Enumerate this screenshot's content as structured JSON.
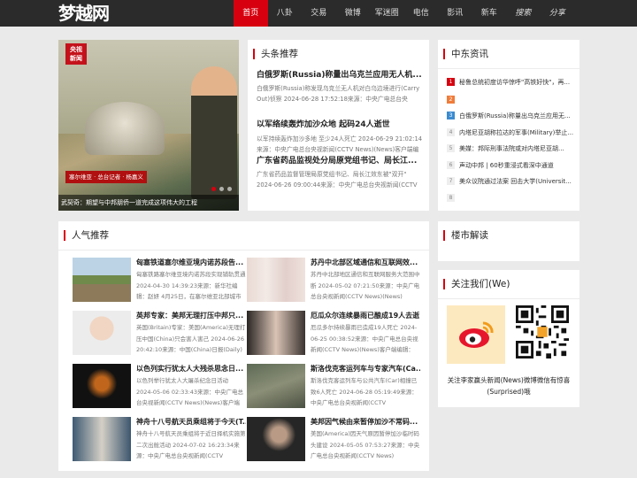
{
  "brand": {
    "logo": "梦越网",
    "accent": "#d7000f"
  },
  "nav": [
    {
      "label": "首页",
      "active": true
    },
    {
      "label": "八卦"
    },
    {
      "label": "交易"
    },
    {
      "label": "微博"
    },
    {
      "label": "军迷圈"
    },
    {
      "label": "电信"
    },
    {
      "label": "影讯"
    },
    {
      "label": "新车"
    },
    {
      "label": "搜索"
    },
    {
      "label": "分享"
    }
  ],
  "hero": {
    "logo_top": "央视",
    "logo_bottom": "新闻",
    "tag": "塞尔维亚 · 总台记者 · 杨嘉义",
    "caption": "武契奇：期望与中邦朋侨一道完成这项伟大的工程",
    "dots": 3
  },
  "headlines": {
    "title": "头条推荐",
    "items": [
      {
        "title": "白俄罗斯(Russia)称量出乌克兰应用无人机...",
        "desc": "白俄罗斯(Russia)称发现乌克兰无人机对白乌边境进行(Carry Out)侦察 2024-06-28 17:52:18来源：中央广电总台央"
      },
      {
        "title": "以军络续轰炸加沙众地 起码24人逝世",
        "desc": "以军持续轰炸加沙多地 至少24人死亡 2024-06-29 21:02:14来源：中央广电总台央视新闻(CCTV News)(News)客户端编辑："
      },
      {
        "title": "广东省药品监视处分局原党组书记、局长江...",
        "desc": "广东省药品监督管理局原党组书记、局长江效东被\"双开\" 2024-06-26 09:00:44来源：中央广电总台央视新闻(CCTV"
      }
    ]
  },
  "middle_east": {
    "title": "中东资讯",
    "items": [
      {
        "num": "1",
        "text": "秘鲁总统初度访华惊呼\"高铁好快\"，再..."
      },
      {
        "num": "2",
        "text": ""
      },
      {
        "num": "3",
        "text": "白俄罗斯(Russia)称量出乌克兰应用无..."
      },
      {
        "num": "4",
        "text": "内塔尼亚胡称拉达的军事(Military)举止..."
      },
      {
        "num": "5",
        "text": "美媒：邦际刑事法院或对内塔尼亚胡..."
      },
      {
        "num": "6",
        "text": "声动中邦 | 60秒重浸式看深中通道"
      },
      {
        "num": "7",
        "text": "美众议院通过法案 回击大学(Universit..."
      },
      {
        "num": "8",
        "text": ""
      }
    ]
  },
  "popular": {
    "title": "人气推荐",
    "items": [
      {
        "title": "匈塞铁道塞尔维亚境内诺苏段告...",
        "desc": "匈塞铁路塞尔维亚境内诺苏段实现铺轨贯通 2024-04-30 14:39:23来源：新华社编辑：赵妍 4月25日，在塞尔维亚北部城市"
      },
      {
        "title": "苏丹中北部区域通信和互联网效...",
        "desc": "苏丹中北部地区通信和互联网服务大范围中断 2024-05-02 07:21:50来源：中央广电总台央视新闻(CCTV News)(News)"
      },
      {
        "title": "英邦专家：美邦无理打压中邦只...",
        "desc": "英国(Britain)专家：美国(America)无理打压中国(China)只会害人害己 2024-06-26 20:42:10来源：中国(China)日报(Daily)网"
      },
      {
        "title": "厄瓜众尔连续暴雨已酿成19人去逝",
        "desc": "厄瓜多尔持续暴雨已造成19人死亡 2024-06-25 00:38:52来源：中央广电总台央视新闻(CCTV News)(News)客户端编辑："
      },
      {
        "title": "以色列实行犹太人大残杀思念日...",
        "desc": "以色列举行犹太人大屠杀纪念日活动 2024-05-06 02:33:43来源：中央广电总台央视新闻(CCTV News)(News)客户端"
      },
      {
        "title": "斯洛伐克客运列车与专家汽车(Ca...",
        "desc": "斯洛伐克客运列车与公共汽车(Car)相撞已致6人死亡 2024-06-28 05:19:49来源：中央广电总台央视新闻(CCTV"
      },
      {
        "title": "神舟十八号航天员乘组将于今天(T...",
        "desc": "神舟十八号航天员乘组将于近日择机实施第二次出舱活动 2024-07-02 16:23:34来源：中央广电总台央视新闻(CCTV"
      },
      {
        "title": "美邦因气候由来暂停加沙不常码...",
        "desc": "美国(America)因天气原因暂停加沙临时码头建设 2024-05-05 07:53:27来源：中央广电总台央视新闻(CCTV News)"
      }
    ]
  },
  "market": {
    "title": "楼市解读"
  },
  "follow": {
    "title": "关注我们(We)",
    "text": "关注李家赢头新闻(News)微博微信有惊喜(Surprised)哦"
  }
}
